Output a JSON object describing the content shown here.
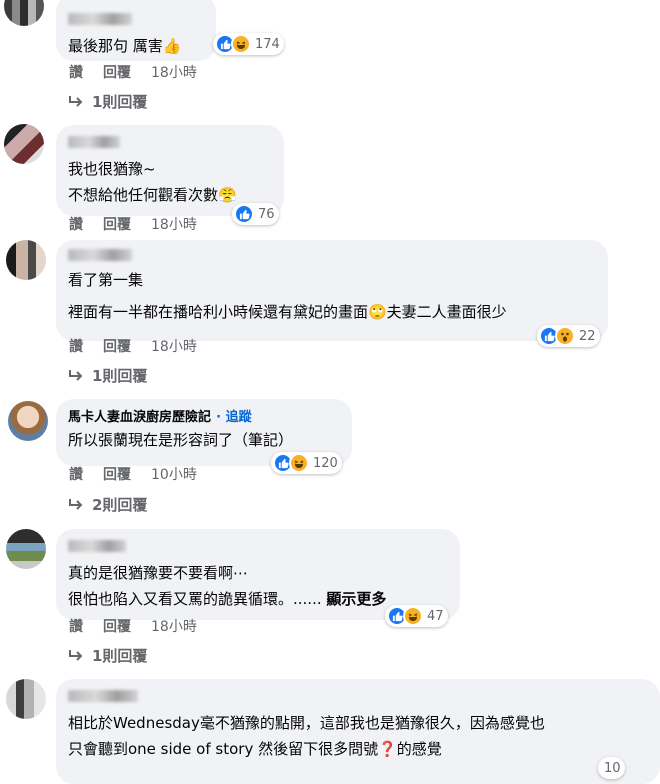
{
  "comments": [
    {
      "name": "",
      "lines": [
        "最後那句 厲害👍"
      ],
      "reaction_count": "174",
      "reactions": [
        "like-icon",
        "haha-icon"
      ],
      "actions": {
        "like": "讚",
        "reply": "回覆",
        "time": "18小時"
      },
      "replies_label": "1則回覆"
    },
    {
      "name": "",
      "lines": [
        "我也很猶豫~",
        "不想給他任何觀看次數😤"
      ],
      "reaction_count": "76",
      "reactions": [
        "like-icon"
      ],
      "actions": {
        "like": "讚",
        "reply": "回覆",
        "time": "18小時"
      },
      "replies_label": ""
    },
    {
      "name": "",
      "lines": [
        "看了第一集",
        "",
        "裡面有一半都在播哈利小時候還有黛妃的畫面🙄夫妻二人畫面很少"
      ],
      "reaction_count": "22",
      "reactions": [
        "like-icon",
        "wow-icon"
      ],
      "actions": {
        "like": "讚",
        "reply": "回覆",
        "time": "18小時"
      },
      "replies_label": "1則回覆"
    },
    {
      "name": "馬卡人妻血淚廚房歷險記",
      "follow": "追蹤",
      "lines": [
        "所以張蘭現在是形容詞了（筆記）"
      ],
      "reaction_count": "120",
      "reactions": [
        "like-icon",
        "haha-icon"
      ],
      "actions": {
        "like": "讚",
        "reply": "回覆",
        "time": "10小時"
      },
      "replies_label": "2則回覆"
    },
    {
      "name": "",
      "lines": [
        "真的是很猶豫要不要看啊⋯",
        "很怕也陷入又看又罵的詭異循環。......"
      ],
      "see_more": "顯示更多",
      "reaction_count": "47",
      "reactions": [
        "like-icon",
        "haha-icon"
      ],
      "actions": {
        "like": "讚",
        "reply": "回覆",
        "time": "18小時"
      },
      "replies_label": "1則回覆"
    },
    {
      "name": "",
      "lines": [
        "相比於Wednesday毫不猶豫的點開，這部我也是猶豫很久，因為感覺也",
        "只會聽到one side of story 然後留下很多問號❓的感覺"
      ],
      "reaction_count": "10",
      "reactions": [],
      "actions": {},
      "replies_label": ""
    }
  ],
  "colors": {
    "bubble_bg": "#f0f2f5",
    "like_blue": "#1877f2",
    "haha_yellow": "#f7b125",
    "meta_gray": "#65676b",
    "follow_blue": "#0566d6"
  }
}
